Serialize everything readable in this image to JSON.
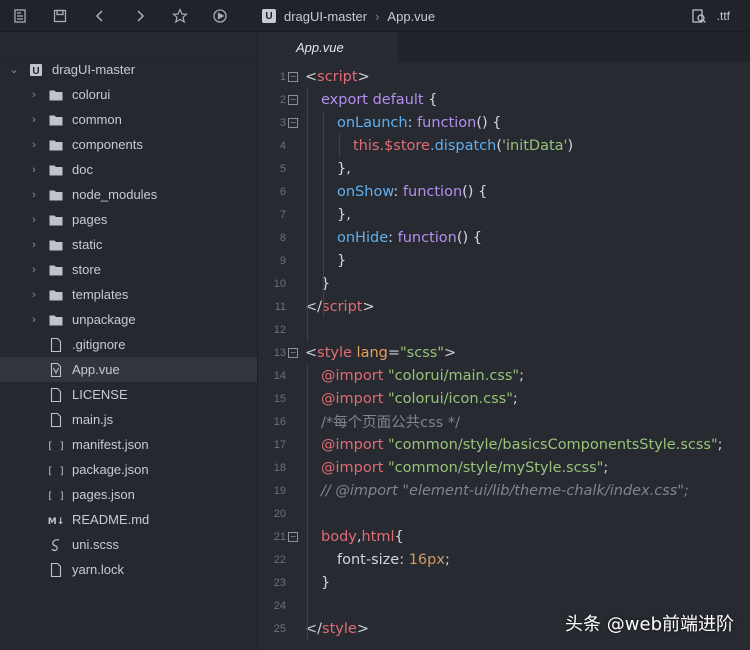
{
  "toolbar": {
    "icons": [
      "new-file-icon",
      "save-icon",
      "back-icon",
      "forward-icon",
      "star-icon",
      "run-icon"
    ]
  },
  "breadcrumb": {
    "project_badge": "U",
    "project": "dragUI-master",
    "file": "App.vue"
  },
  "right_tools": {
    "ext_label": ".ttf"
  },
  "sidebar": {
    "root": "dragUI-master",
    "items": [
      {
        "label": "colorui",
        "type": "folder"
      },
      {
        "label": "common",
        "type": "folder"
      },
      {
        "label": "components",
        "type": "folder"
      },
      {
        "label": "doc",
        "type": "folder"
      },
      {
        "label": "node_modules",
        "type": "folder"
      },
      {
        "label": "pages",
        "type": "folder"
      },
      {
        "label": "static",
        "type": "folder"
      },
      {
        "label": "store",
        "type": "folder"
      },
      {
        "label": "templates",
        "type": "folder"
      },
      {
        "label": "unpackage",
        "type": "folder"
      },
      {
        "label": ".gitignore",
        "type": "file"
      },
      {
        "label": "App.vue",
        "type": "vue"
      },
      {
        "label": "LICENSE",
        "type": "file"
      },
      {
        "label": "main.js",
        "type": "file"
      },
      {
        "label": "manifest.json",
        "type": "json"
      },
      {
        "label": "package.json",
        "type": "json"
      },
      {
        "label": "pages.json",
        "type": "json"
      },
      {
        "label": "README.md",
        "type": "md"
      },
      {
        "label": "uni.scss",
        "type": "scss"
      },
      {
        "label": "yarn.lock",
        "type": "file"
      }
    ]
  },
  "editor": {
    "tab": "App.vue",
    "line_numbers": [
      "1",
      "2",
      "3",
      "4",
      "5",
      "6",
      "7",
      "8",
      "9",
      "10",
      "11",
      "12",
      "13",
      "14",
      "15",
      "16",
      "17",
      "18",
      "19",
      "20",
      "21",
      "22",
      "23",
      "24",
      "25"
    ],
    "code": {
      "l1_tag": "script",
      "l2_export": "export default",
      "l3_fn": "onLaunch",
      "l3_kw": "function",
      "l4_this": "this",
      "l4_store": ".$store",
      "l4_dispatch": ".dispatch",
      "l4_arg": "'initData'",
      "l6_fn": "onShow",
      "l6_kw": "function",
      "l8_fn": "onHide",
      "l8_kw": "function",
      "l10_close": "}",
      "l11_tag": "script",
      "l13_tag": "style",
      "l13_attr": "lang",
      "l13_val": "\"scss\"",
      "imports": [
        "\"colorui/main.css\"",
        "\"colorui/icon.css\"",
        "\"common/style/basicsComponentsStyle.scss\"",
        "\"common/style/myStyle.scss\""
      ],
      "import_kw": "@import",
      "l16_comment": "/*每个页面公共css */",
      "l19_comment": "// @import \"element-ui/lib/theme-chalk/index.css\";",
      "l21_selector_a": "body",
      "l21_selector_b": "html",
      "l22_prop": "font-size",
      "l22_val": "16px",
      "l25_tag": "style"
    }
  },
  "watermark": "头条 @web前端进阶"
}
